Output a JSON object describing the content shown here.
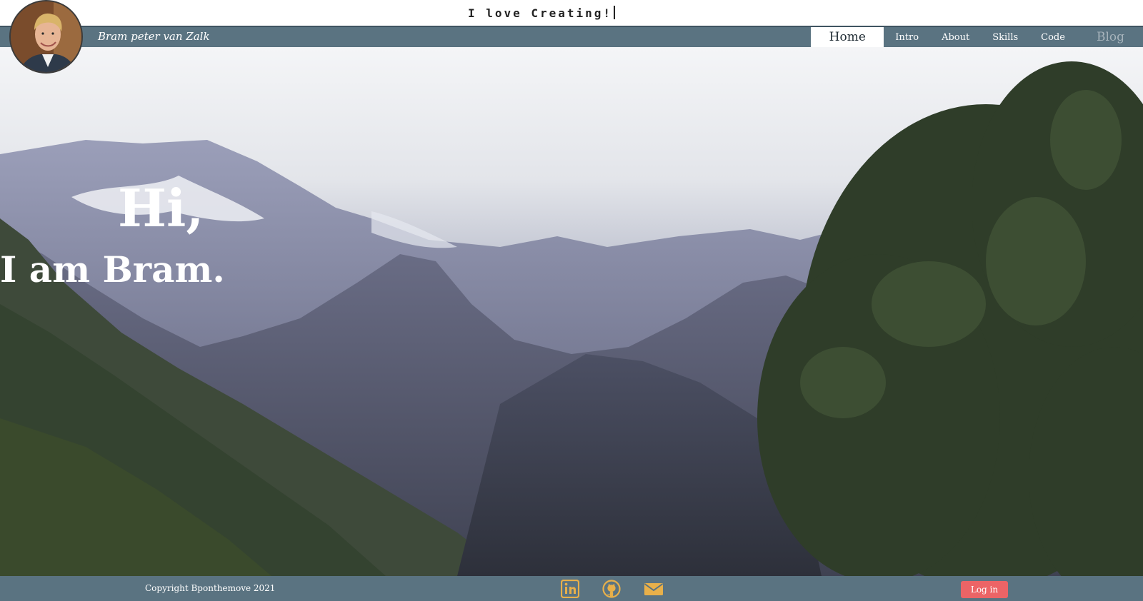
{
  "header": {
    "tagline": "I love Creating!"
  },
  "navbar": {
    "brand": "Bram peter van Zalk",
    "items": [
      {
        "label": "Home",
        "active": true
      },
      {
        "label": "Intro",
        "active": false
      },
      {
        "label": "About",
        "active": false
      },
      {
        "label": "Skills",
        "active": false
      },
      {
        "label": "Code",
        "active": false
      },
      {
        "label": "Blog",
        "active": false
      }
    ]
  },
  "hero": {
    "greeting": "Hi,",
    "intro": "I am Bram."
  },
  "footer": {
    "copyright": "Copyright Bponthemove 2021",
    "social": [
      {
        "icon": "linkedin-icon"
      },
      {
        "icon": "github-icon"
      },
      {
        "icon": "mail-icon"
      }
    ],
    "login_label": "Log in"
  },
  "colors": {
    "nav_background": "#5a7381",
    "icon_accent": "#e8b04a",
    "login_button": "#ec6466"
  }
}
